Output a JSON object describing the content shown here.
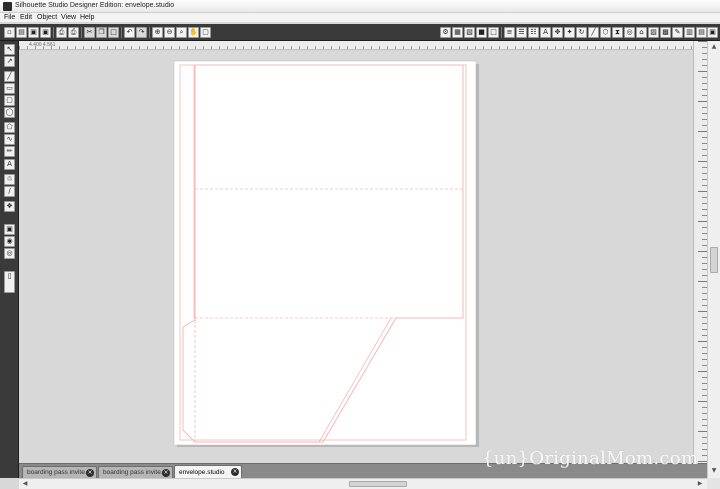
{
  "window": {
    "title": "Silhouette Studio Designer Edition: envelope.studio"
  },
  "menu": [
    "File",
    "Edit",
    "Object",
    "View",
    "Help"
  ],
  "toolbar": {
    "left_icons": [
      "new-document-icon",
      "open-icon",
      "save-icon",
      "save-as-icon",
      "print-icon",
      "print-preview-icon",
      "cut-icon",
      "copy-icon",
      "paste-icon",
      "undo-icon",
      "redo-icon",
      "zoom-in-icon",
      "zoom-out-icon",
      "zoom-select-icon",
      "pan-icon",
      "fit-page-icon"
    ],
    "right_icons": [
      "page-settings-icon",
      "grid-settings-icon",
      "registration-icon",
      "fill-color-icon",
      "line-color-icon",
      "line-style-icon",
      "align-icon",
      "text-style-icon",
      "replicate-icon",
      "transform-icon",
      "modify-icon",
      "offset-icon",
      "trace-icon",
      "cut-settings-icon",
      "send-to-silhouette-icon",
      "library-icon",
      "store-icon"
    ]
  },
  "left_tools": [
    "select-tool-icon",
    "point-edit-icon",
    "line-tool-icon",
    "rectangle-tool-icon",
    "rounded-rect-tool-icon",
    "ellipse-tool-icon",
    "polygon-tool-icon",
    "curve-tool-icon",
    "arc-tool-icon",
    "freehand-tool-icon",
    "text-tool-icon",
    "eraser-tool-icon",
    "knife-tool-icon",
    "sketch-tool-icon",
    "layers-icon",
    "library-panel-icon",
    "online-store-icon",
    "cut-pane-icon"
  ],
  "ruler": {
    "coords": "4.400  4.561"
  },
  "colors": {
    "cut_line": "#f4b8b8",
    "page": "#ffffff",
    "canvas": "#d8d8d8",
    "toolbar": "#3a3a3a"
  },
  "tabs": [
    {
      "label": "boarding pass invite...",
      "active": false
    },
    {
      "label": "boarding pass invite...",
      "active": false
    },
    {
      "label": "envelope.studio",
      "active": true
    }
  ],
  "watermark": "{un}OriginalMom.com"
}
